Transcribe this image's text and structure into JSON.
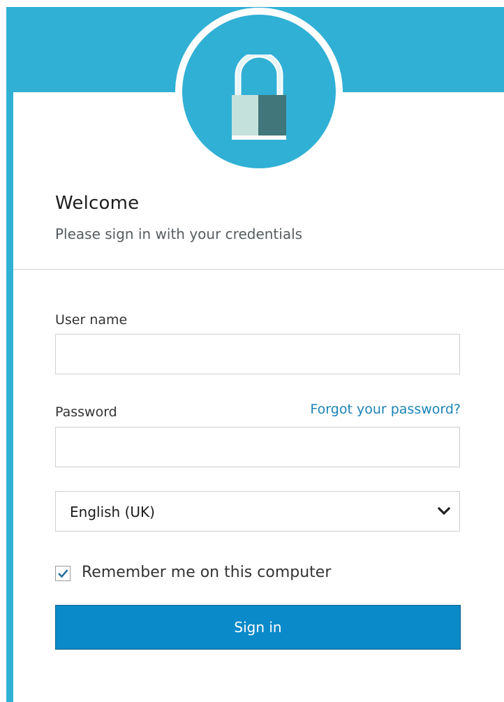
{
  "header": {
    "logo_icon": "padlock-icon",
    "brand_color": "#31b0d5"
  },
  "welcome": {
    "title": "Welcome",
    "subtitle": "Please sign in with your credentials"
  },
  "form": {
    "username_label": "User name",
    "username_value": "",
    "password_label": "Password",
    "password_value": "",
    "forgot_link": "Forgot your password?",
    "language_selected": "English (UK)",
    "remember_label": "Remember me on this computer",
    "remember_checked": true,
    "signin_label": "Sign in"
  },
  "colors": {
    "primary_button": "#0b8ac9",
    "link": "#1b83b6"
  }
}
